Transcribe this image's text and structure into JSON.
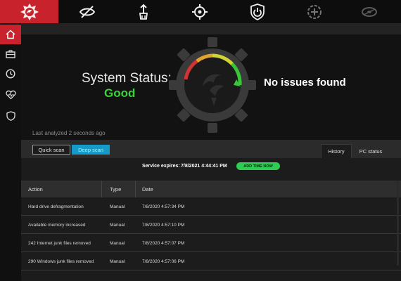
{
  "toolbar": {
    "logo": "phoenix-logo",
    "icons": [
      "privacy-icon",
      "cleanup-icon",
      "target-icon",
      "power-icon",
      "optimize-icon",
      "disk-icon"
    ]
  },
  "sidebar": {
    "items": [
      {
        "icon": "home-icon",
        "active": true
      },
      {
        "icon": "toolbox-icon",
        "active": false
      },
      {
        "icon": "clock-icon",
        "active": false
      },
      {
        "icon": "heart-icon",
        "active": false
      },
      {
        "icon": "shield-icon",
        "active": false
      }
    ]
  },
  "status": {
    "label": "System Status:",
    "value": "Good",
    "message": "No issues found",
    "last_analyzed": "Last analyzed 2 seconds ago"
  },
  "scan": {
    "quick_label": "Quick scan",
    "deep_label": "Deep scan"
  },
  "tabs": {
    "history": "History",
    "pc_status": "PC status"
  },
  "service": {
    "label": "Service expires:",
    "date": "7/8/2021 4:44:41 PM",
    "add_time": "ADD TIME NOW"
  },
  "table": {
    "headers": [
      "Action",
      "Type",
      "Date"
    ],
    "rows": [
      {
        "action": "Hard drive defragmentation",
        "type": "Manual",
        "date": "7/8/2020 4:57:34 PM"
      },
      {
        "action": "Available memory increased",
        "type": "Manual",
        "date": "7/8/2020 4:57:10 PM"
      },
      {
        "action": "242 Internet junk files removed",
        "type": "Manual",
        "date": "7/8/2020 4:57:07 PM"
      },
      {
        "action": "290 Windows junk files removed",
        "type": "Manual",
        "date": "7/8/2020 4:57:06 PM"
      }
    ]
  },
  "colors": {
    "brand": "#c8232c",
    "good": "#3bd23b",
    "deep_scan": "#159bc8",
    "add_time": "#2ecc52"
  }
}
